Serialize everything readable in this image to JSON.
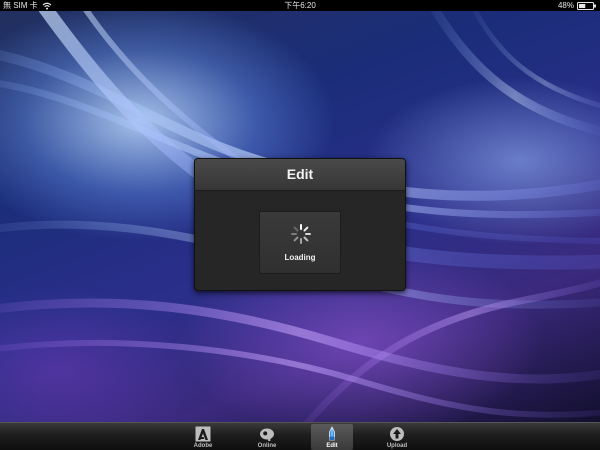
{
  "status_bar": {
    "carrier": "無 SIM 卡",
    "time": "下午6:20",
    "battery": "48%",
    "battery_level": 0.48
  },
  "modal": {
    "title": "Edit",
    "loading_text": "Loading"
  },
  "tab_bar": {
    "tabs": [
      {
        "label": "Adobe",
        "icon": "adobe-logo-icon",
        "active": false
      },
      {
        "label": "Online",
        "icon": "online-icon",
        "active": false
      },
      {
        "label": "Edit",
        "icon": "edit-pen-icon",
        "active": true
      },
      {
        "label": "Upload",
        "icon": "upload-icon",
        "active": false
      }
    ]
  },
  "colors": {
    "modal_bg": "#262626",
    "tab_active": "#ffffff",
    "tab_inactive": "#bdbdbd",
    "edit_icon_accent": "#3c8ee0"
  }
}
